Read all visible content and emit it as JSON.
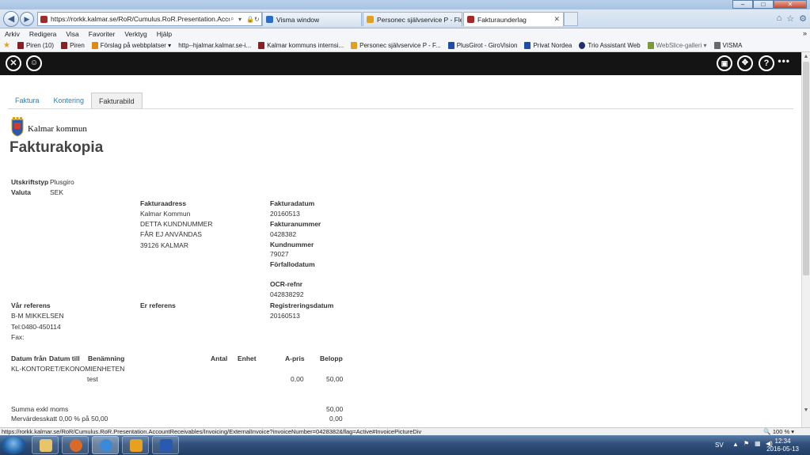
{
  "window": {
    "controls": {
      "minimize": "–",
      "maximize": "□",
      "close": "✕"
    }
  },
  "browser": {
    "back_icon": "back-arrow-icon",
    "forward_icon": "forward-arrow-icon",
    "address": "https://rorkk.kalmar.se/RoR/Cumulus.RoR.Presentation.AccountF",
    "tabs": [
      {
        "label": "Visma window",
        "color": "#2b6cc4"
      },
      {
        "label": "Personec självservice P - Flexst...",
        "color": "#e0a020"
      },
      {
        "label": "Fakturaunderlag",
        "color": "#a32a2a",
        "close": "✕"
      }
    ]
  },
  "menu": [
    "Arkiv",
    "Redigera",
    "Visa",
    "Favoriter",
    "Verktyg",
    "Hjälp"
  ],
  "favorites": [
    {
      "label": "Piren (10)",
      "color": "#8a1f1f"
    },
    {
      "label": "Piren",
      "color": "#8a1f1f"
    },
    {
      "label": "Förslag på webbplatser ▾",
      "color": "#e08a10"
    },
    {
      "label": "http--hjalmar.kalmar.se-i...",
      "color": "#a32a2a"
    },
    {
      "label": "Kalmar kommuns internsi...",
      "color": "#8a1f1f"
    },
    {
      "label": "Personec självservice P - F...",
      "color": "#e0a020"
    },
    {
      "label": "PlusGirot - GiroVision",
      "color": "#1f4fa0"
    },
    {
      "label": "Privat  Nordea",
      "color": "#1f4fa0"
    },
    {
      "label": "Trio Assistant Web",
      "color": "#1f2f70"
    },
    {
      "label": "WebSlice-galleri ▾",
      "color": "#7a9a3a"
    },
    {
      "label": "VISMA",
      "color": "#6a6a6a"
    }
  ],
  "tabs": [
    "Faktura",
    "Kontering",
    "Fakturabild"
  ],
  "org_name": "Kalmar kommun",
  "doc_title": "Fakturakopia",
  "header_fields": {
    "utskriftstyp_label": "Utskriftstyp",
    "utskriftstyp_value": "Plusgiro",
    "valuta_label": "Valuta",
    "valuta_value": "SEK"
  },
  "address": {
    "label": "Fakturaadress",
    "lines": [
      "Kalmar Kommun",
      "DETTA KUNDNUMMER",
      "FÅR EJ ANVÄNDAS",
      "39126 KALMAR"
    ]
  },
  "invoice_info": {
    "fakturadatum_label": "Fakturadatum",
    "fakturadatum": "20160513",
    "fakturanummer_label": "Fakturanummer",
    "fakturanummer": "0428382",
    "kundnummer_label": "Kundnummer",
    "kundnummer": "79027",
    "forfallodatum_label": "Förfallodatum",
    "ocr_label": "OCR-refnr",
    "ocr": "042838292",
    "registreringsdatum_label": "Registreringsdatum",
    "registreringsdatum": "20160513"
  },
  "references": {
    "var_label": "Vår referens",
    "var_name": "B-M MIKKELSEN",
    "tel": "Tel:0480-450114",
    "fax": "Fax:",
    "er_label": "Er referens"
  },
  "table": {
    "headers": [
      "Datum från",
      "Datum till",
      "Benämning",
      "Antal",
      "Enhet",
      "A-pris",
      "Belopp"
    ],
    "group": "KL-KONTORET/EKONOMIENHETEN",
    "row": {
      "benamning": "test",
      "apris": "0,00",
      "belopp": "50,00"
    }
  },
  "summary": {
    "exkl_label": "Summa exkl moms",
    "exkl_value": "50,00",
    "moms_label": "Mervärdesskatt 0,00 % på 50,00",
    "moms_value": "0,00"
  },
  "status": {
    "url": "https://rorkk.kalmar.se/RoR/Cumulus.RoR.Presentation.AccountReceivables/Invoicing/ExternalInvoice?invoiceNumber=0428382&flag=Active#InvoicePictureDiv",
    "zoom": "100 %"
  },
  "taskbar": {
    "lang": "SV",
    "time": "12:34",
    "date": "2016-05-13"
  }
}
